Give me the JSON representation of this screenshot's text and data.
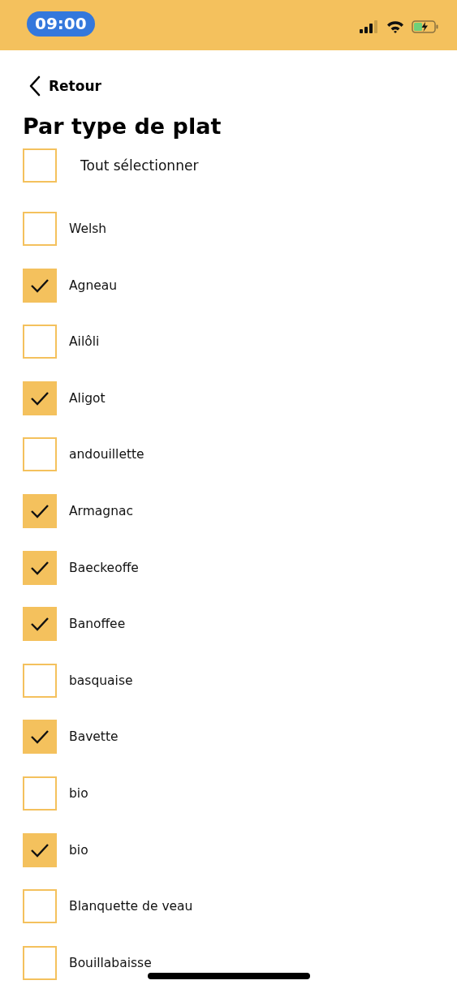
{
  "status_bar": {
    "time": "09:00"
  },
  "back": {
    "label": "Retour"
  },
  "title": "Par type de plat",
  "select_all": {
    "label": "Tout sélectionner",
    "checked": false
  },
  "items": [
    {
      "label": "Welsh",
      "checked": false
    },
    {
      "label": "Agneau",
      "checked": true
    },
    {
      "label": "Ailôli",
      "checked": false
    },
    {
      "label": "Aligot",
      "checked": true
    },
    {
      "label": "andouillette",
      "checked": false
    },
    {
      "label": "Armagnac",
      "checked": true
    },
    {
      "label": "Baeckeoffe",
      "checked": true
    },
    {
      "label": "Banoffee",
      "checked": true
    },
    {
      "label": "basquaise",
      "checked": false
    },
    {
      "label": "Bavette",
      "checked": true
    },
    {
      "label": "bio",
      "checked": false
    },
    {
      "label": "bio",
      "checked": true
    },
    {
      "label": "Blanquette de veau",
      "checked": false
    },
    {
      "label": "Bouillabaisse",
      "checked": false
    }
  ]
}
